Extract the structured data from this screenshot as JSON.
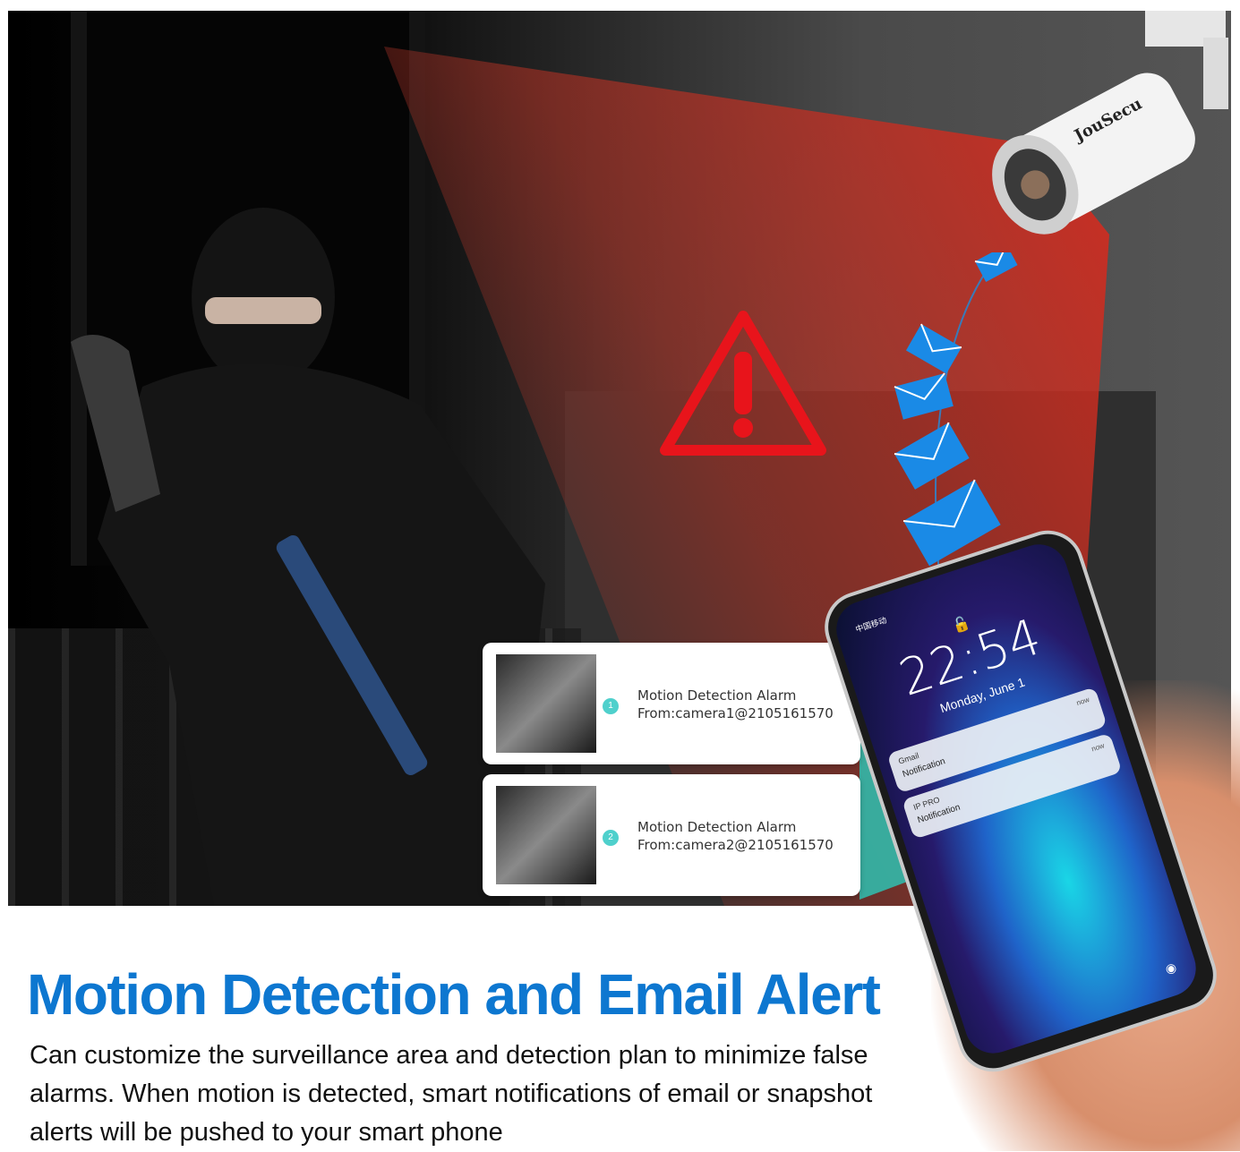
{
  "brand": {
    "camera_logo": "JouSecu"
  },
  "alerts": [
    {
      "number": "1",
      "title": "Motion Detection Alarm",
      "from": "From:camera1@2105161570"
    },
    {
      "number": "2",
      "title": "Motion Detection Alarm",
      "from": "From:camera2@2105161570"
    }
  ],
  "phone": {
    "carrier": "中国移动",
    "time": "22:54",
    "date": "Monday, June 1",
    "notifications": [
      {
        "app": "Gmail",
        "body": "Notification",
        "time": "now"
      },
      {
        "app": "IP PRO",
        "body": "Notification",
        "time": "now"
      }
    ]
  },
  "headline": "Motion Detection and Email Alert",
  "description": "Can customize the surveillance area and detection plan to minimize false alarms. When motion is detected, smart notifications of email or snapshot alerts will be pushed to your smart phone",
  "colors": {
    "headline": "#0d77d0",
    "warning": "#e8141b",
    "envelope": "#1a8ae6",
    "teal_beam": "#2fc1b2"
  },
  "icons": [
    "warning-triangle-icon",
    "envelope-icon",
    "lock-icon",
    "camera-icon"
  ]
}
